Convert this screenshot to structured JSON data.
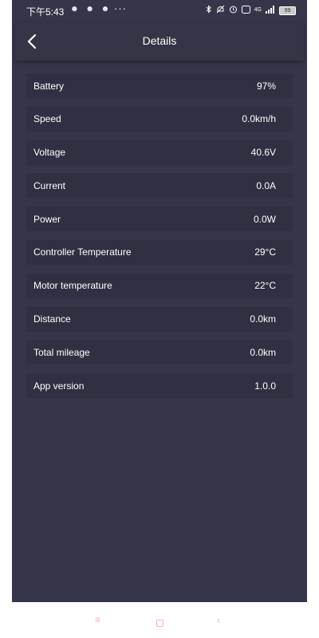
{
  "status_bar": {
    "time": "下午5:43",
    "notification_icons": "☻ ☻ ☻",
    "more": "···",
    "network": "4G",
    "battery_level": "99"
  },
  "header": {
    "title": "Details"
  },
  "details": [
    {
      "label": "Battery",
      "value": "97%"
    },
    {
      "label": "Speed",
      "value": "0.0km/h"
    },
    {
      "label": "Voltage",
      "value": "40.6V"
    },
    {
      "label": "Current",
      "value": "0.0A"
    },
    {
      "label": "Power",
      "value": "0.0W"
    },
    {
      "label": "Controller Temperature",
      "value": "29°C"
    },
    {
      "label": "Motor temperature",
      "value": "22°C"
    },
    {
      "label": "Distance",
      "value": "0.0km"
    },
    {
      "label": "Total mileage",
      "value": "0.0km"
    },
    {
      "label": "App version",
      "value": "1.0.0"
    }
  ],
  "nav_bar": {
    "menu_glyph": "≡",
    "back_glyph": "‹"
  },
  "colors": {
    "screen_bg": "#353649",
    "row_bg": "#2f3042",
    "nav_icon": "#f4b2b2"
  }
}
